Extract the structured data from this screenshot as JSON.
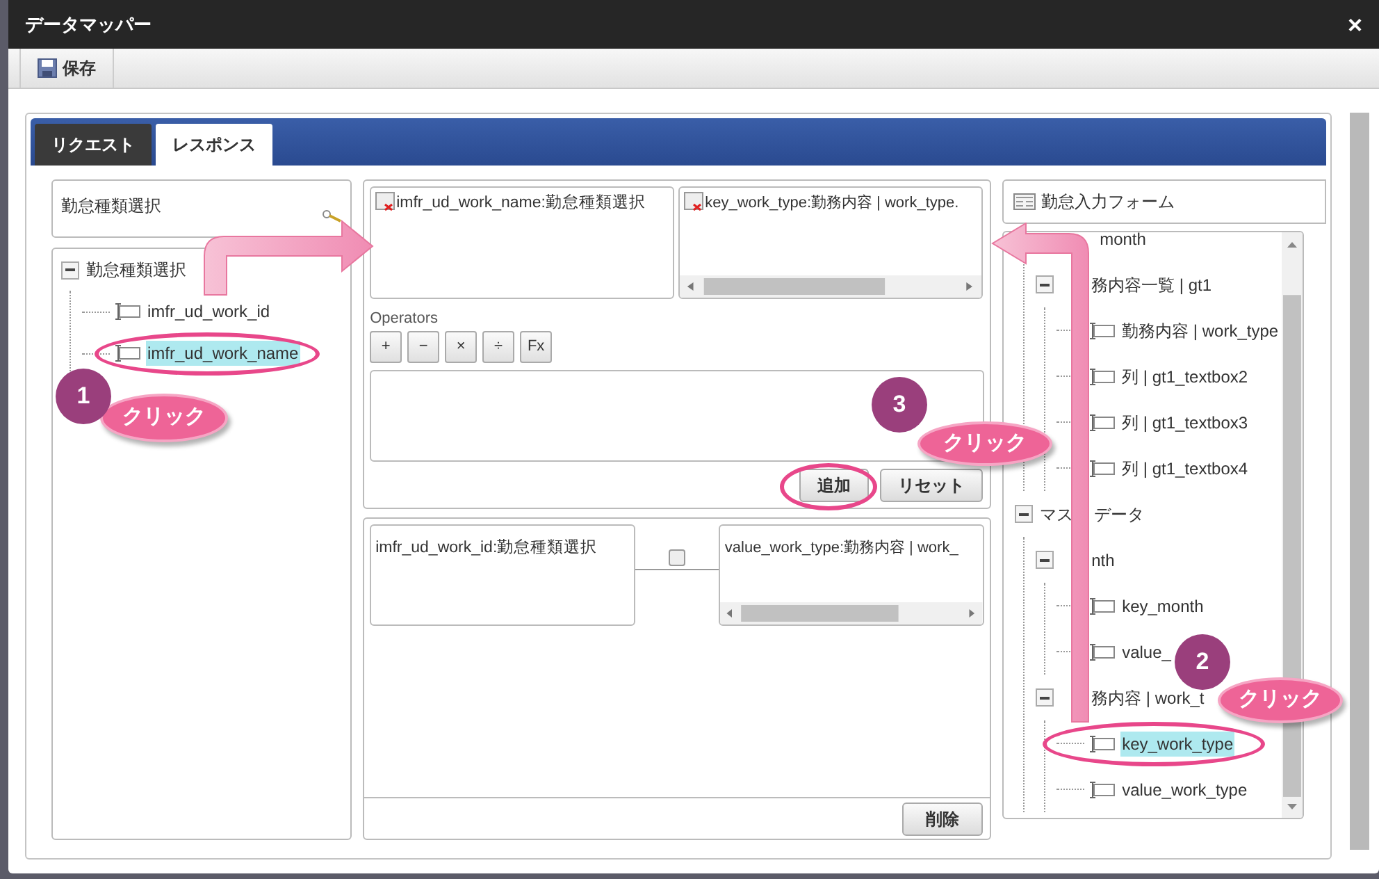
{
  "window": {
    "title": "データマッパー",
    "close": "×"
  },
  "toolbar": {
    "save": "保存"
  },
  "tabs": [
    {
      "label": "リクエスト",
      "selected": false
    },
    {
      "label": "レスポンス",
      "selected": true
    }
  ],
  "source": {
    "title": "勤怠種類選択",
    "tree": [
      {
        "label": "勤怠種類選択",
        "expanded": true,
        "selected": false,
        "children": [
          {
            "label": "imfr_ud_work_id",
            "selected": false
          },
          {
            "label": "imfr_ud_work_name",
            "selected": true
          }
        ]
      }
    ]
  },
  "mapping": {
    "source_box": "imfr_ud_work_name:勤怠種類選択",
    "target_box": "key_work_type:勤務内容 | work_type.",
    "operators_label": "Operators",
    "operators": [
      "+",
      "−",
      "×",
      "÷",
      "Fx"
    ],
    "add": "追加",
    "reset": "リセット",
    "mapped": [
      {
        "source": "imfr_ud_work_id:勤怠種類選択",
        "checked": false,
        "target": "value_work_type:勤務内容 | work_"
      }
    ],
    "delete": "削除"
  },
  "target": {
    "title": "勤怠入力フォーム",
    "tree": [
      {
        "children": [
          {
            "label": "month",
            "selected": false,
            "covered": true
          },
          {
            "label": "務内容一覧 | gt1",
            "expanded": true,
            "selected": false,
            "covered": true,
            "children": [
              {
                "label": "勤務内容 | work_type",
                "selected": false
              },
              {
                "label": "列 | gt1_textbox2",
                "selected": false
              },
              {
                "label": "列 | gt1_textbox3",
                "selected": false
              },
              {
                "label": "列 | gt1_textbox4",
                "selected": false
              }
            ]
          }
        ]
      },
      {
        "label": "マス",
        "label_after": "データ",
        "expanded": true,
        "selected": false,
        "covered": false,
        "children": [
          {
            "label": "nth",
            "expanded": true,
            "selected": false,
            "covered": true,
            "children": [
              {
                "label": "key_month",
                "selected": false
              },
              {
                "label": "value_",
                "selected": false
              }
            ]
          },
          {
            "label": "務内容 | work_t",
            "expanded": true,
            "selected": false,
            "covered": true,
            "children": [
              {
                "label": "key_work_type",
                "selected": true
              },
              {
                "label": "value_work_type",
                "selected": false
              }
            ]
          }
        ]
      }
    ]
  },
  "callouts": [
    {
      "number": "1",
      "label": "クリック"
    },
    {
      "number": "2",
      "label": "クリック"
    },
    {
      "number": "3",
      "label": "クリック"
    }
  ]
}
